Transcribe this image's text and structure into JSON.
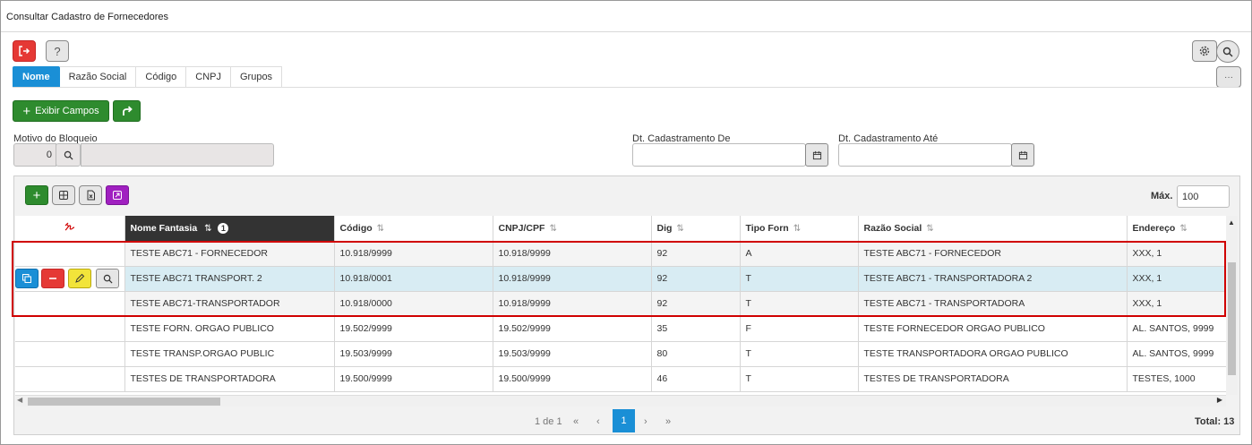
{
  "window": {
    "title": "Consultar Cadastro de Fornecedores"
  },
  "toolbar": {
    "exit_icon": "exit-icon",
    "help_label": "?",
    "settings_icon": "gear-icon",
    "search_icon": "search-icon",
    "more_label": "···"
  },
  "tabs": [
    {
      "label": "Nome",
      "active": true
    },
    {
      "label": "Razão Social"
    },
    {
      "label": "Código"
    },
    {
      "label": "CNPJ"
    },
    {
      "label": "Grupos"
    }
  ],
  "actions": {
    "exibir_campos": "Exibir Campos"
  },
  "filters": {
    "motivo_label": "Motivo do Bloqueio",
    "motivo_value": "0",
    "dt_de_label": "Dt. Cadastramento De",
    "dt_ate_label": "Dt. Cadastramento Até"
  },
  "grid": {
    "max_label": "Máx.",
    "max_value": "100",
    "columns": [
      "Nome Fantasia",
      "Código",
      "CNPJ/CPF",
      "Dig",
      "Tipo Forn",
      "Razão Social",
      "Endereço"
    ],
    "sort_badge": "1",
    "rows": [
      [
        "TESTE ABC71 - FORNECEDOR",
        "10.918/9999",
        "10.918/9999",
        "92",
        "A",
        "TESTE ABC71 - FORNECEDOR",
        "XXX, 1"
      ],
      [
        "TESTE ABC71 TRANSPORT. 2",
        "10.918/0001",
        "10.918/9999",
        "92",
        "T",
        "TESTE ABC71 - TRANSPORTADORA 2",
        "XXX, 1"
      ],
      [
        "TESTE ABC71-TRANSPORTADOR",
        "10.918/0000",
        "10.918/9999",
        "92",
        "T",
        "TESTE ABC71 - TRANSPORTADORA",
        "XXX, 1"
      ],
      [
        "TESTE FORN. ORGAO PUBLICO",
        "19.502/9999",
        "19.502/9999",
        "35",
        "F",
        "TESTE FORNECEDOR ORGAO PUBLICO",
        "AL. SANTOS, 9999"
      ],
      [
        "TESTE TRANSP.ORGAO PUBLIC",
        "19.503/9999",
        "19.503/9999",
        "80",
        "T",
        "TESTE TRANSPORTADORA ORGAO PUBLICO",
        "AL. SANTOS, 9999"
      ],
      [
        "TESTES DE TRANSPORTADORA",
        "19.500/9999",
        "19.500/9999",
        "46",
        "T",
        "TESTES DE TRANSPORTADORA",
        "TESTES, 1000"
      ]
    ]
  },
  "pager": {
    "info": "1 de 1",
    "first": "«",
    "prev": "‹",
    "current": "1",
    "next": "›",
    "last": "»",
    "total": "Total: 13"
  },
  "colors": {
    "accent": "#1a8fd6",
    "danger": "#e53935",
    "success": "#2e8b2e",
    "highlight": "#d00000"
  }
}
